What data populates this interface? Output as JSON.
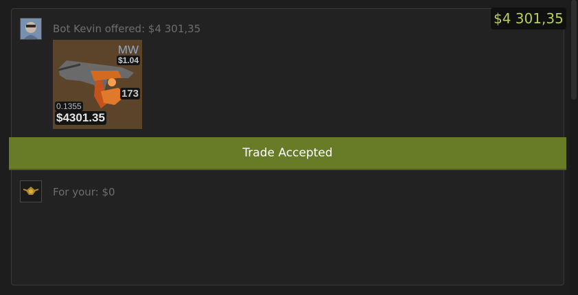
{
  "header": {
    "total": "$4 301,35"
  },
  "offer": {
    "label": "Bot Kevin offered: $4 301,35",
    "item": {
      "wear": "MW",
      "wear_price": "$1.04",
      "quantity": "173",
      "float": "0.1355",
      "price": "$4301.35"
    }
  },
  "status": {
    "text": "Trade Accepted"
  },
  "receive": {
    "label": "For your: $0"
  },
  "colors": {
    "accent_green": "#687c28",
    "total_text": "#b6cf5a"
  }
}
